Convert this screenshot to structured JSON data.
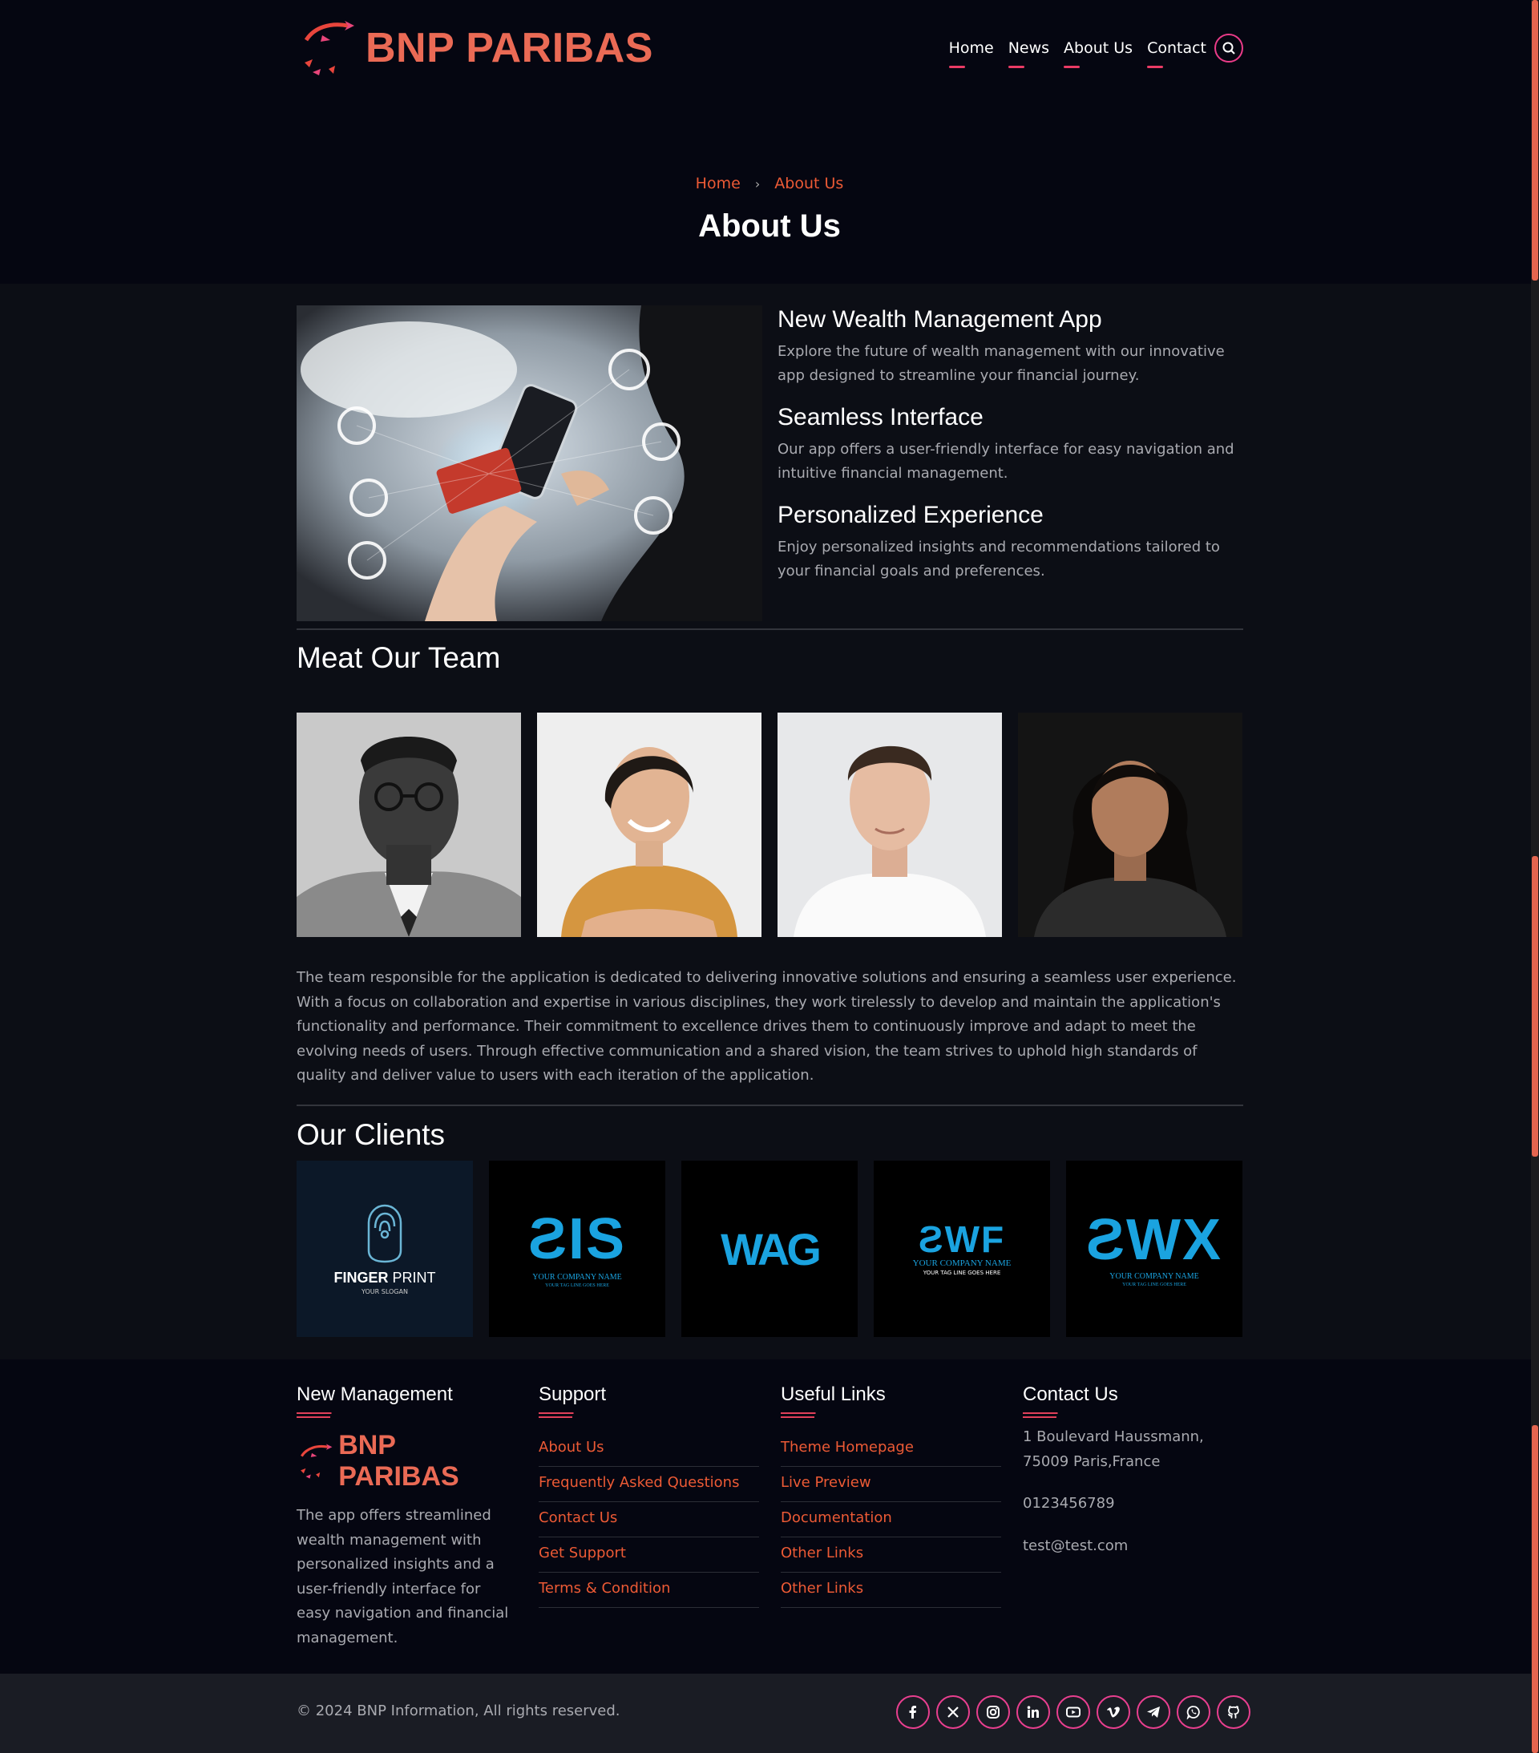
{
  "brand": {
    "name": "BNP PARIBAS",
    "color": "#ea6a55"
  },
  "nav": {
    "items": [
      "Home",
      "News",
      "About Us",
      "Contact"
    ]
  },
  "hero": {
    "breadcrumb_home": "Home",
    "breadcrumb_current": "About Us",
    "title": "About Us"
  },
  "features": [
    {
      "title": "New Wealth Management App",
      "text": "Explore the future of wealth management with our innovative app designed to streamline your financial journey."
    },
    {
      "title": "Seamless Interface",
      "text": "Our app offers a user-friendly interface for easy navigation and intuitive financial management."
    },
    {
      "title": "Personalized Experience",
      "text": "Enjoy personalized insights and recommendations tailored to your financial goals and preferences."
    }
  ],
  "team": {
    "title": "Meat Our Team",
    "text": "The team responsible for the application is dedicated to delivering innovative solutions and ensuring a seamless user experience. With a focus on collaboration and expertise in various disciplines, they work tirelessly to develop and maintain the application's functionality and performance. Their commitment to excellence drives them to continuously improve and adapt to meet the evolving needs of users. Through effective communication and a shared vision, the team strives to uphold high standards of quality and deliver value to users with each iteration of the application."
  },
  "clients": {
    "title": "Our Clients",
    "fingerprint": {
      "name_a": "FINGER",
      "name_b": "PRINT",
      "slogan": "YOUR SLOGAN"
    },
    "logo2": {
      "mark": "ƧIS",
      "company": "YOUR COMPANY NAME",
      "tagline": "YOUR TAG LINE GOES HERE"
    },
    "logo3": {
      "mark": "WAG"
    },
    "logo4": {
      "mark": "ƧWF",
      "company": "YOUR COMPANY NAME",
      "tagline": "YOUR TAG LINE GOES HERE"
    },
    "logo5": {
      "mark": "ƧWX",
      "company": "YOUR COMPANY NAME",
      "tagline": "YOUR TAG LINE GOES HERE"
    }
  },
  "footer": {
    "col1": {
      "title": "New Management",
      "desc": "The app offers streamlined wealth management with personalized insights and a user-friendly interface for easy navigation and financial management."
    },
    "col2": {
      "title": "Support",
      "links": [
        "About Us",
        "Frequently Asked Questions",
        "Contact Us",
        "Get Support",
        "Terms & Condition"
      ]
    },
    "col3": {
      "title": "Useful Links",
      "links": [
        "Theme Homepage",
        "Live Preview",
        "Documentation",
        "Other Links",
        "Other Links"
      ]
    },
    "col4": {
      "title": "Contact Us",
      "address": "1 Boulevard Haussmann, 75009 Paris,France",
      "phone": "0123456789",
      "email": "test@test.com"
    },
    "copyright": "© 2024 BNP Information, All rights reserved.",
    "socials": [
      "facebook-icon",
      "x-icon",
      "instagram-icon",
      "linkedin-icon",
      "youtube-icon",
      "vimeo-icon",
      "telegram-icon",
      "whatsapp-icon",
      "github-icon"
    ]
  }
}
